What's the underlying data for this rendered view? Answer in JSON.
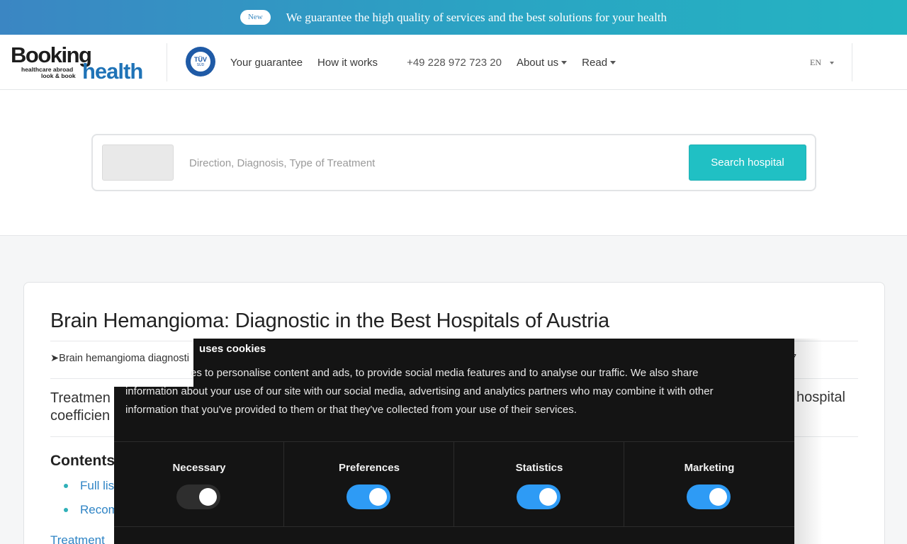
{
  "banner": {
    "badge": "New",
    "text": "We guarantee the high quality of services and the best solutions for your health"
  },
  "header": {
    "logo": {
      "word1": "Booking",
      "word2": "health",
      "tagline1": "healthcare abroad",
      "tagline2": "look & book"
    },
    "certificate": {
      "line1": "TÜV",
      "line2": "SÜD"
    },
    "nav": {
      "guarantee": "Your guarantee",
      "how_it_works": "How it works",
      "phone": "+49 228 972 723 20",
      "about": "About us",
      "read": "Read"
    },
    "language": "EN"
  },
  "search": {
    "placeholder": "Direction, Diagnosis, Type of Treatment",
    "value": "",
    "button": "Search hospital"
  },
  "article": {
    "title": "Brain Hemangioma: Diagnostic in the Best Hospitals of Austria",
    "breadcrumb": "➤Brain hemangioma diagnosti",
    "breadcrumb_tail": "7",
    "intro_line1": "Treatmen",
    "intro_line2": "coefficien",
    "intro_tail": "l hospital",
    "contents_heading": "Contents",
    "toc": [
      "Full lis",
      "Recom"
    ],
    "treatment_link": "Treatment"
  },
  "cookie": {
    "title": "uses cookies",
    "body_line1": "es to personalise content and ads, to provide social media features and to analyse our traffic. We also share",
    "body_line2": "information about your use of our site with our social media, advertising and analytics partners who may combine it with other",
    "body_line3": "information that you've provided to them or that they've collected from your use of their services.",
    "toggles": [
      {
        "label": "Necessary",
        "on": false
      },
      {
        "label": "Preferences",
        "on": true
      },
      {
        "label": "Statistics",
        "on": true
      },
      {
        "label": "Marketing",
        "on": true
      }
    ]
  },
  "colors": {
    "accent_teal": "#20c0c4",
    "link_blue": "#2f84c5",
    "toggle_on": "#2e9bf5",
    "cookie_bg": "#141414"
  }
}
